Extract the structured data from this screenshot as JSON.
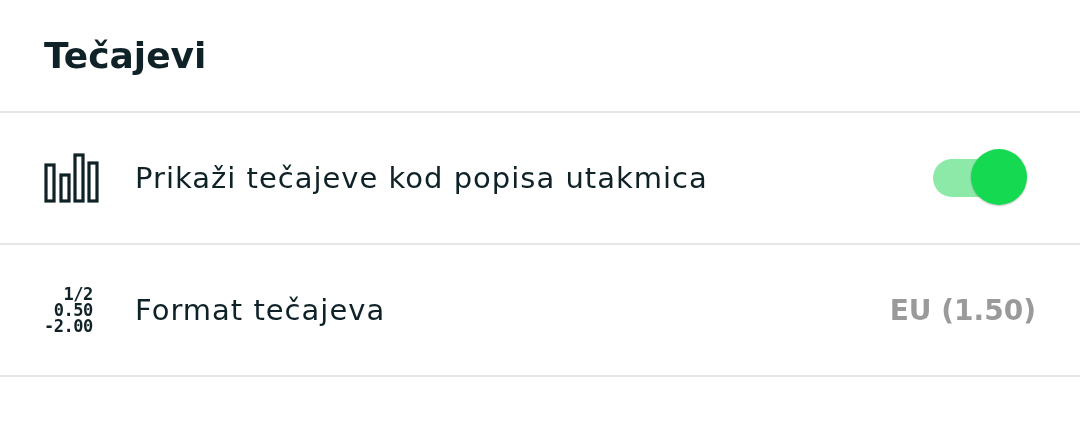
{
  "header": {
    "title": "Tečajevi"
  },
  "rows": [
    {
      "kind": "toggle",
      "label": "Prikaži tečajeve kod popisa utakmica",
      "on": true
    },
    {
      "kind": "value",
      "icon_text": "1/2\n0.50\n-2.00",
      "label": "Format tečajeva",
      "value": "EU (1.50)"
    }
  ]
}
